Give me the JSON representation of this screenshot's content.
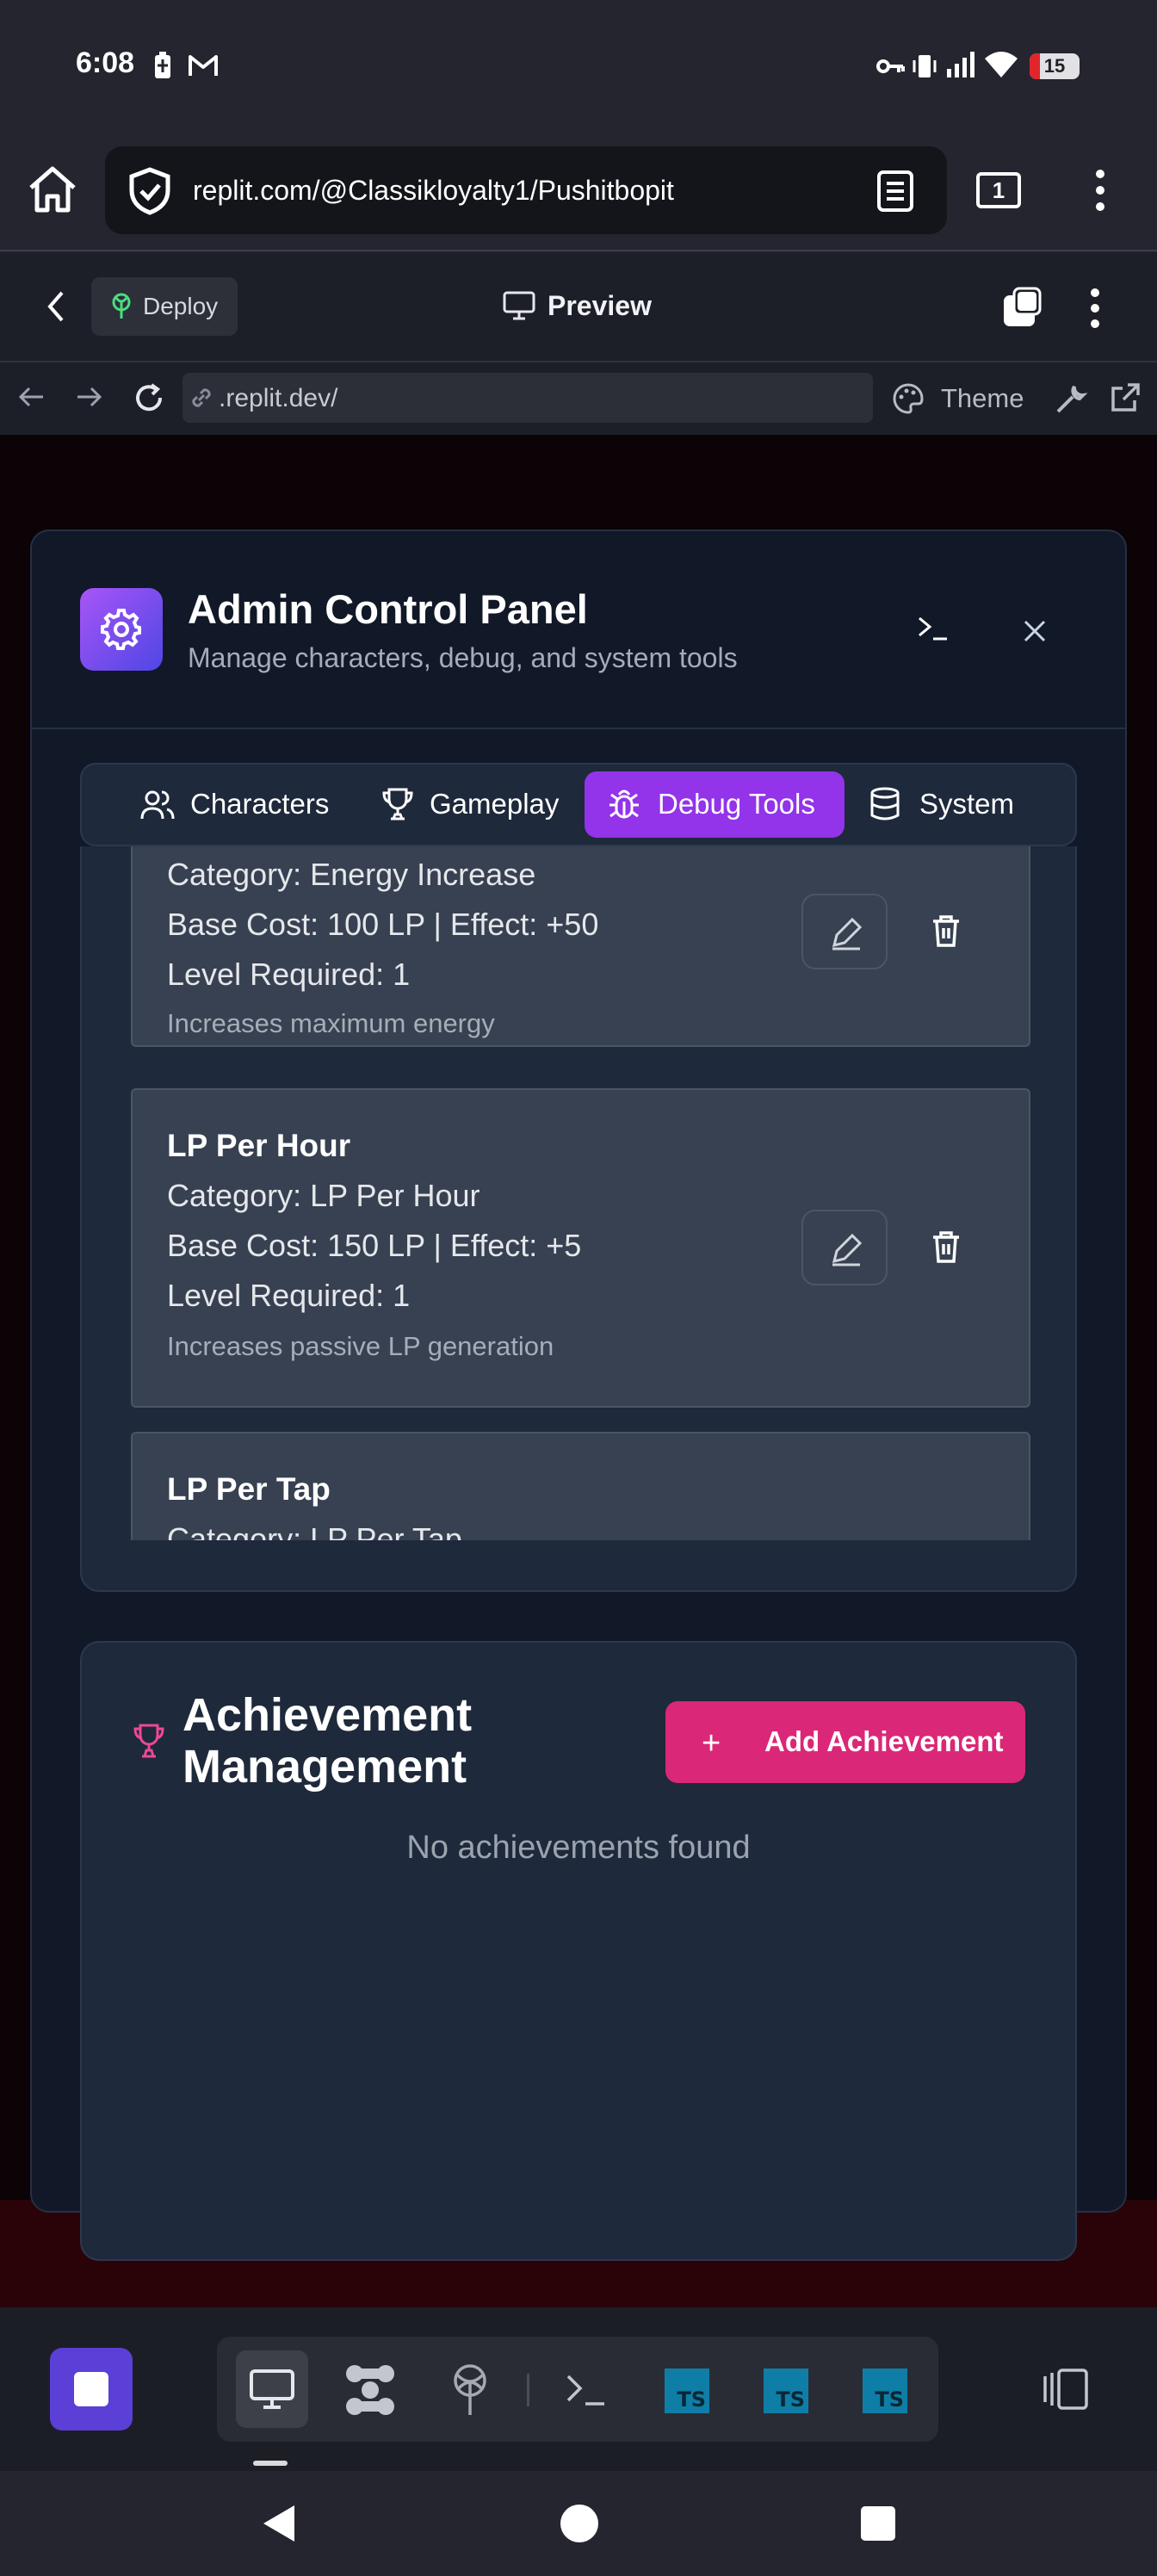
{
  "status_bar": {
    "time": "6:08",
    "battery_level": "15",
    "icons": [
      "battery-saver-icon",
      "gmail-icon",
      "vpn-key-icon",
      "vibrate-icon",
      "signal-icon",
      "wifi-icon",
      "battery-icon"
    ]
  },
  "browser": {
    "url": "replit.com/@Classikloyalty1/Pushitbopit",
    "tab_count": "1"
  },
  "replit_header": {
    "deploy_label": "Deploy",
    "preview_label": "Preview"
  },
  "preview_bar": {
    "url": ".replit.dev/",
    "theme_label": "Theme"
  },
  "modal": {
    "title": "Admin Control Panel",
    "subtitle": "Manage characters, debug, and system tools",
    "close_glyph": "✕",
    "terminal_glyph": ">_"
  },
  "tabs": [
    {
      "label": "Characters",
      "active": false
    },
    {
      "label": "Gameplay",
      "active": false
    },
    {
      "label": "Debug Tools",
      "active": true
    },
    {
      "label": "System",
      "active": false
    }
  ],
  "upgrades": [
    {
      "title": "",
      "category": "Category: Energy Increase",
      "cost_effect": "Base Cost: 100 LP | Effect: +50",
      "level": "Level Required: 1",
      "description": "Increases maximum energy"
    },
    {
      "title": "LP Per Hour",
      "category": "Category: LP Per Hour",
      "cost_effect": "Base Cost: 150 LP | Effect: +5",
      "level": "Level Required: 1",
      "description": "Increases passive LP generation"
    },
    {
      "title": "LP Per Tap",
      "category": "Category: LP Per Tap"
    }
  ],
  "achievements": {
    "title_line1": "Achievement",
    "title_line2": "Management",
    "add_button_label": "Add Achievement",
    "add_glyph": "+",
    "empty_text": "No achievements found"
  },
  "colors": {
    "accent_purple": "#9333ea",
    "accent_pink": "#db2777",
    "modal_bg": "#111827",
    "card_bg": "#1e293b",
    "item_bg": "#374151"
  }
}
